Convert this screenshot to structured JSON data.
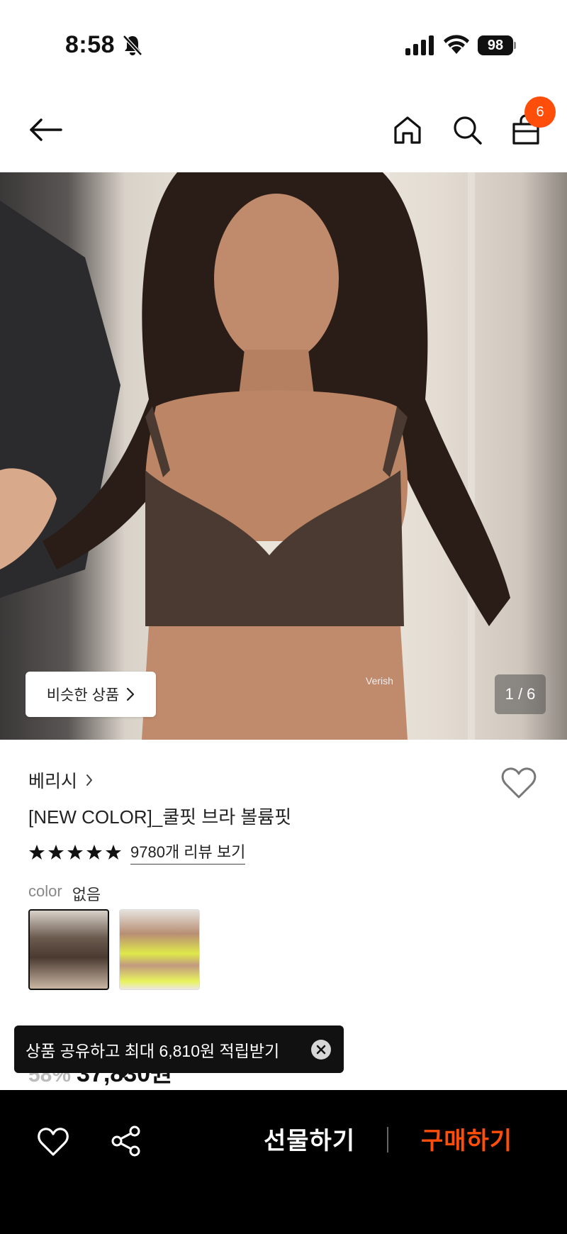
{
  "status_bar": {
    "time": "8:58",
    "battery": "98"
  },
  "nav": {
    "cart_count": "6"
  },
  "gallery": {
    "similar_label": "비슷한 상품",
    "pager": "1 / 6",
    "watermark": "Verish"
  },
  "product": {
    "brand": "베리시",
    "title": "[NEW COLOR]_쿨핏 브라 볼륨핏",
    "rating_stars": 5,
    "review_link": "9780개 리뷰 보기",
    "color_label": "color",
    "color_value": "없음",
    "discount": "58%",
    "price": "37,830원"
  },
  "toast": {
    "message": "상품 공유하고 최대 6,810원 적립받기"
  },
  "bottom_bar": {
    "gift_label": "선물하기",
    "buy_label": "구매하기"
  },
  "colors": {
    "accent": "#ff4d0a",
    "bottom_bar_bg": "#000000"
  },
  "icons": [
    "bell-off-icon",
    "signal-icon",
    "wifi-icon",
    "battery-icon",
    "back-arrow-icon",
    "home-icon",
    "search-icon",
    "bag-icon",
    "chevron-right-icon",
    "heart-icon",
    "star-icon",
    "close-icon",
    "share-icon"
  ]
}
